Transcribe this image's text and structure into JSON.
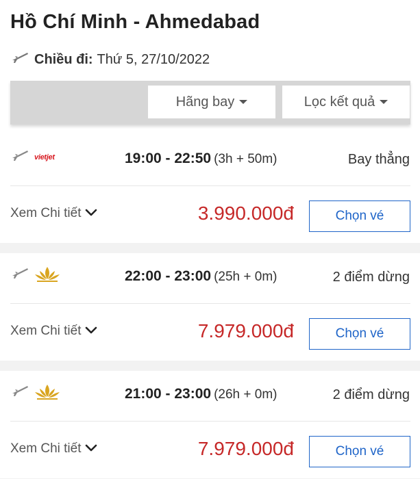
{
  "header": {
    "route_title": "Hồ Chí Minh - Ahmedabad",
    "depart_label": "Chiều đi:",
    "depart_date": "Thứ 5, 27/10/2022",
    "plane_icon": "plane-icon"
  },
  "filters": {
    "airline_label": "Hãng bay",
    "result_label": "Lọc kết quả",
    "caret_icon": "caret-down-icon"
  },
  "colors": {
    "price": "#c62828",
    "button_accent": "#1e64c8",
    "vietjet_red": "#d71920",
    "vna_gold": "#d9a520"
  },
  "flights": [
    {
      "airline_logo": "vietjet-logo",
      "airline_logo_text": "vietjet",
      "times": "19:00 - 22:50",
      "duration": "(3h + 50m)",
      "stops": "Bay thẳng",
      "details_label": "Xem Chi tiết",
      "price": "3.990.000đ",
      "choose_label": "Chọn vé"
    },
    {
      "airline_logo": "vietnam-airlines-lotus-logo",
      "times": "22:00 - 23:00",
      "duration": "(25h + 0m)",
      "stops": "2 điểm dừng",
      "details_label": "Xem Chi tiết",
      "price": "7.979.000đ",
      "choose_label": "Chọn vé"
    },
    {
      "airline_logo": "vietnam-airlines-lotus-logo",
      "times": "21:00 - 23:00",
      "duration": "(26h + 0m)",
      "stops": "2 điểm dừng",
      "details_label": "Xem Chi tiết",
      "price": "7.979.000đ",
      "choose_label": "Chọn vé"
    }
  ]
}
